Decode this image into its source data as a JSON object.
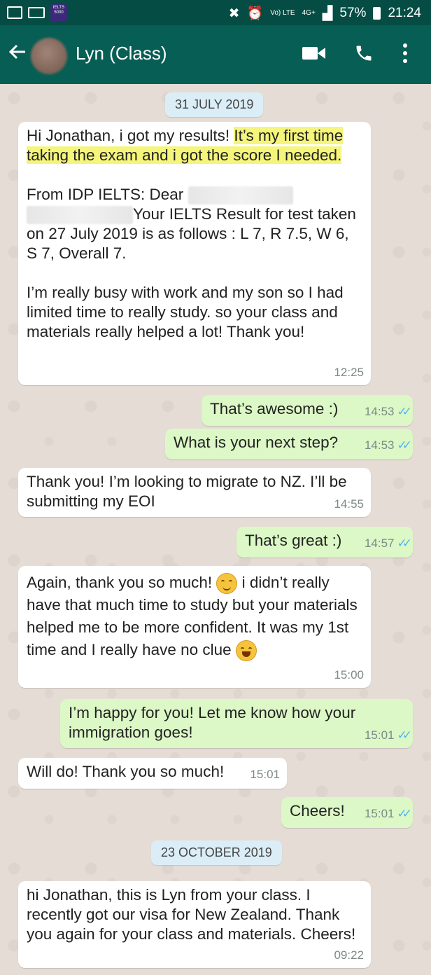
{
  "status_bar": {
    "app_badge": "IELTS 5000",
    "network_volte": "Vo) LTE",
    "network_4g": "4G+",
    "battery": "57%",
    "time": "21:24"
  },
  "header": {
    "contact_name": "Lyn (Class)",
    "icons": [
      "back-arrow-icon",
      "avatar",
      "video-call-icon",
      "phone-icon",
      "more-options-icon"
    ]
  },
  "date_1": "31 JULY 2019",
  "date_2": "23 OCTOBER 2019",
  "messages": [
    {
      "direction": "in",
      "text_pre": "Hi Jonathan, i got my results! ",
      "text_highlight": "It’s my first time taking the exam and i got the score I needed.",
      "text_p2_start": "From IDP IELTS: Dear",
      "text_p2_mid": "Your IELTS Result for test taken on 27 July 2019 is as follows : L 7, R 7.5, W 6, S 7, Overall 7.",
      "text_p3": "I’m really busy with work and my son so I had limited time to really study. so your class and materials really helped a lot! Thank you!",
      "time": "12:25"
    },
    {
      "direction": "out",
      "text": "That’s awesome :)",
      "time": "14:53"
    },
    {
      "direction": "out",
      "text": "What is your next step?",
      "time": "14:53"
    },
    {
      "direction": "in",
      "text": "Thank you! I’m looking to migrate to NZ. I’ll be submitting my EOI",
      "time": "14:55"
    },
    {
      "direction": "out",
      "text": "That’s great :)",
      "time": "14:57"
    },
    {
      "direction": "in",
      "text_a": "Again, thank you so much! ",
      "text_b": " i didn’t really have that much time to study but your materials helped me to be more confident. It was my 1st time and I really have no clue",
      "time": "15:00"
    },
    {
      "direction": "out",
      "text": "I’m happy for you! Let me know how your immigration goes!",
      "time": "15:01"
    },
    {
      "direction": "in",
      "text": "Will do! Thank you so much!",
      "time": "15:01"
    },
    {
      "direction": "out",
      "text": "Cheers!",
      "time": "15:01"
    },
    {
      "direction": "in",
      "text": "hi Jonathan, this is Lyn from your class. I recently got our visa for New Zealand. Thank you again for your class and materials. Cheers!",
      "time": "09:22"
    }
  ],
  "colors": {
    "header": "#075e54",
    "status_bar": "#054d44",
    "incoming_bubble": "#ffffff",
    "outgoing_bubble": "#dcf8c6",
    "read_ticks": "#4fb6ec",
    "highlight": "#f4f57a"
  }
}
